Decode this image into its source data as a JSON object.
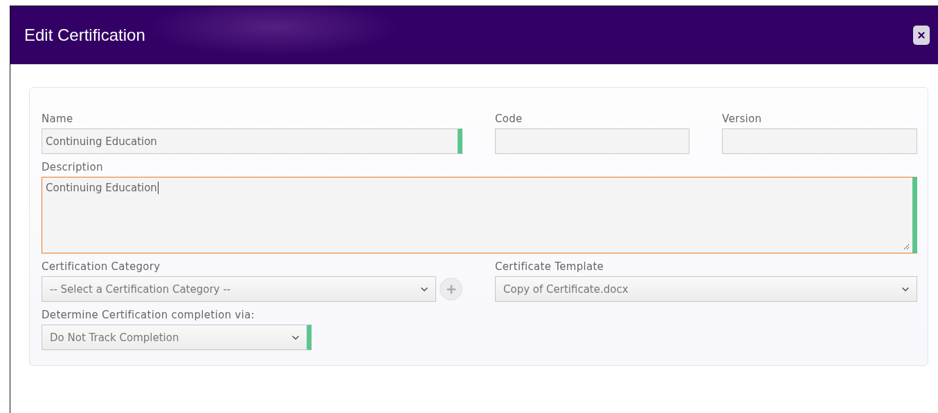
{
  "dialog": {
    "title": "Edit Certification"
  },
  "fields": [
    {
      "kind": "input",
      "label": "Name",
      "value": "Continuing Education",
      "required": true
    },
    {
      "kind": "input",
      "label": "Code",
      "required": false
    },
    {
      "kind": "input",
      "label": "Version",
      "required": false
    },
    {
      "kind": "textarea",
      "label": "Description",
      "value": "Continuing Education",
      "required": true,
      "focused": true
    },
    {
      "kind": "select-add",
      "label": "Certification Category",
      "value": "-- Select a Certification Category --",
      "required": false
    },
    {
      "kind": "select",
      "label": "Certificate Template",
      "value": "Copy of Certificate.docx",
      "required": false
    },
    {
      "kind": "select",
      "label": "Determine Certification completion via:",
      "value": "Do Not Track Completion",
      "required": true
    }
  ]
}
